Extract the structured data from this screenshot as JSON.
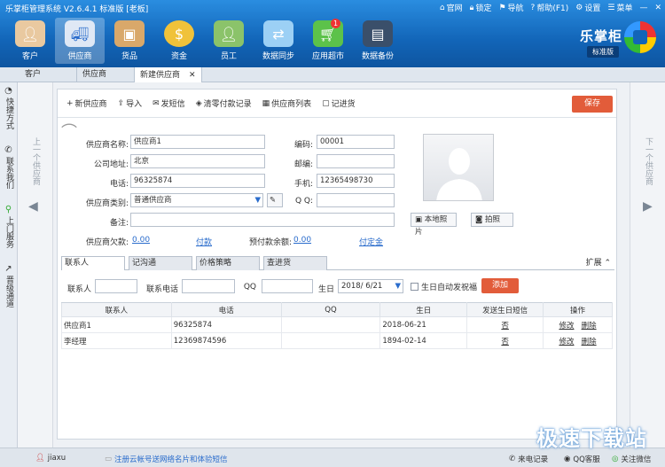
{
  "app": {
    "title": "乐掌柜管理系统 V2.6.4.1 标准版 [老板]",
    "brand": "乐掌柜",
    "edition": "标准版"
  },
  "topmenu": [
    "官网",
    "锁定",
    "导航",
    "帮助(F1)",
    "设置",
    "菜单"
  ],
  "nav": [
    {
      "label": "客户",
      "icon": "customer-icon"
    },
    {
      "label": "供应商",
      "icon": "supplier-truck-icon",
      "active": true
    },
    {
      "label": "货品",
      "icon": "goods-box-icon"
    },
    {
      "label": "资金",
      "icon": "money-bag-icon"
    },
    {
      "label": "员工",
      "icon": "employee-icon"
    },
    {
      "label": "数据同步",
      "icon": "sync-icon"
    },
    {
      "label": "应用超市",
      "icon": "app-market-cart-icon",
      "badge": "1"
    },
    {
      "label": "数据备份",
      "icon": "backup-icon"
    }
  ],
  "tabs": [
    "客户",
    "供应商",
    "新建供应商"
  ],
  "left_sidebar": [
    {
      "label": "快捷方式",
      "icon": "shortcut-icon"
    },
    {
      "label": "联系我们",
      "icon": "phone-icon"
    },
    {
      "label": "上门服务",
      "icon": "bicycle-icon"
    },
    {
      "label": "晋级通道",
      "icon": "chart-icon"
    }
  ],
  "prev_label": "上一个供应商",
  "next_label": "下一个供应商",
  "toolbar": {
    "new": "新供应商",
    "import": "导入",
    "sms": "发短信",
    "clear": "清零付款记录",
    "list": "供应商列表",
    "history": "记进货",
    "save": "保存"
  },
  "form": {
    "name_label": "供应商名称:",
    "name": "供应商1",
    "code_label": "编码:",
    "code": "00001",
    "address_label": "公司地址:",
    "address": "北京",
    "postcode_label": "邮编:",
    "postcode": "",
    "phone_label": "电话:",
    "phone": "96325874",
    "mobile_label": "手机:",
    "mobile": "12365498730",
    "category_label": "供应商类别:",
    "category": "普通供应商",
    "qq_label": "Q Q:",
    "qq": "",
    "remark_label": "备注:",
    "remark": "",
    "debt_label": "供应商欠款:",
    "debt": "0.00",
    "pay": "付款",
    "prepay_label": "预付款余额:",
    "prepay": "0.00",
    "prepay_btn": "付定金",
    "local_photo": "本地照片",
    "take_photo": "拍照"
  },
  "subtabs": [
    "联系人",
    "记沟通",
    "价格策略",
    "查进货"
  ],
  "expand": "扩展",
  "contact_form": {
    "contact_label": "联系人",
    "phone_label": "联系电话",
    "qq_label": "QQ",
    "birthday_label": "生日",
    "birthday": "2018/ 6/21",
    "auto_bless": "生日自动发祝福",
    "add": "添加"
  },
  "contacts_table": {
    "headers": [
      "联系人",
      "电话",
      "QQ",
      "生日",
      "发送生日短信",
      "操作"
    ],
    "rows": [
      {
        "name": "供应商1",
        "phone": "96325874",
        "qq": "",
        "birthday": "2018-06-21",
        "sms": "否",
        "edit": "修改",
        "del": "删除"
      },
      {
        "name": "李经理",
        "phone": "12369874596",
        "qq": "",
        "birthday": "1894-02-14",
        "sms": "否",
        "edit": "修改",
        "del": "删除"
      }
    ]
  },
  "status": {
    "user": "jiaxu",
    "notice": "注册云帐号送网络名片和体验短信",
    "caller": "来电记录",
    "qq_service": "QQ客服",
    "wechat": "关注微信"
  },
  "watermark": "极速下载站"
}
